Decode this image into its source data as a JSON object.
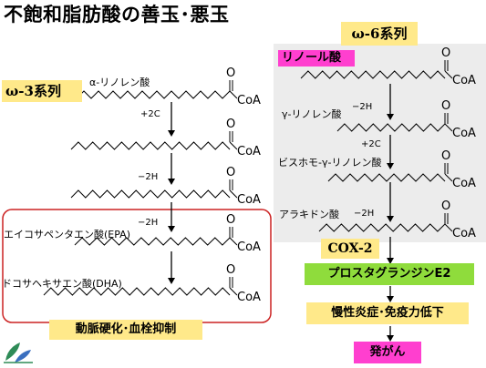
{
  "title": "不飽和脂肪酸の善玉･悪玉",
  "omega3": {
    "header": "ω-3系列",
    "compounds": [
      "α-リノレン酸",
      "エイコサペンタエン酸(EPA)",
      "ドコサヘキサエン酸(DHA)"
    ],
    "steps": [
      "+2C",
      "−2H"
    ],
    "effect": "動脈硬化･血栓抑制"
  },
  "omega6": {
    "header": "ω-6系列",
    "compounds": [
      "リノール酸",
      "γ-リノレン酸",
      "ビスホモ-γ-リノレン酸",
      "アラキドン酸"
    ],
    "steps": [
      "−2H",
      "+2C",
      "−2H"
    ],
    "enzyme": "COX-2",
    "product": "プロスタグランジンE2",
    "effect": "慢性炎症･免疫力低下",
    "outcome": "発がん"
  },
  "structure": {
    "o_label": "O",
    "coa_label": "CoA"
  },
  "colors": {
    "highlight": "#ffe98a",
    "magenta": "#ff3fcf",
    "green": "#8fdc3c",
    "red_frame": "#cc2222"
  }
}
